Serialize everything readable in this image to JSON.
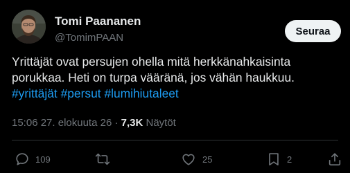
{
  "author": {
    "name": "Tomi Paananen",
    "handle": "@TomimPAAN",
    "avatar_icon": "profile-photo"
  },
  "follow_button": {
    "label": "Seuraa"
  },
  "tweet": {
    "lines": [
      "Yrittäjät ovat persujen ohella mitä herkkänahkaisinta",
      "porukkaa. Heti on turpa vääränä, jos vähän haukkuu."
    ],
    "hashtags": [
      "#yrittäjät",
      "#persut",
      "#lumihiutaleet"
    ]
  },
  "meta": {
    "timestamp": "15:06 27. elokuuta 26",
    "separator": "·",
    "views_count": "7,3K",
    "views_label": "Näytöt"
  },
  "actions": {
    "reply": {
      "icon": "reply-icon",
      "count": "109"
    },
    "repost": {
      "icon": "repost-icon",
      "count": ""
    },
    "like": {
      "icon": "heart-icon",
      "count": "25"
    },
    "bookmark": {
      "icon": "bookmark-icon",
      "count": "2"
    },
    "share": {
      "icon": "share-icon",
      "count": ""
    }
  },
  "colors": {
    "background": "#000000",
    "text_primary": "#e7e9ea",
    "text_secondary": "#71767b",
    "link": "#1d9bf0",
    "follow_button_bg": "#eff3f4",
    "divider": "#2f3336"
  }
}
